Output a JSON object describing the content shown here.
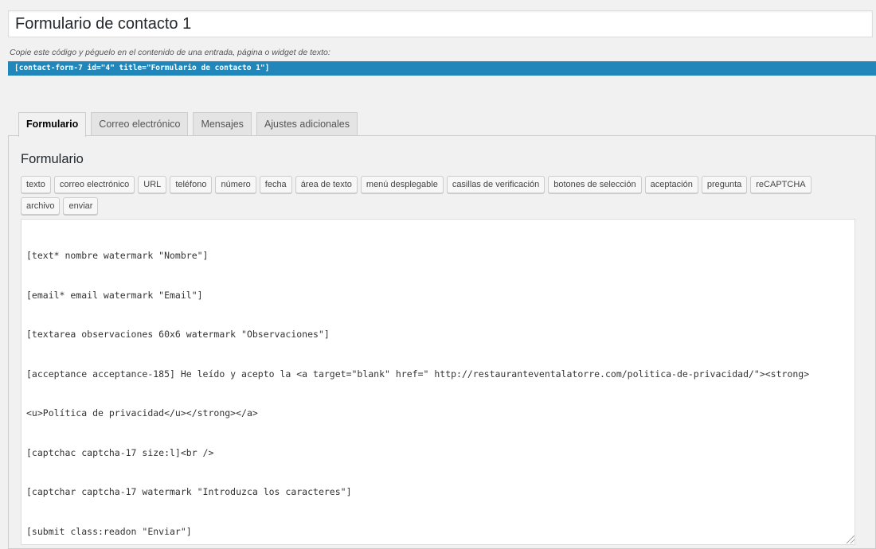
{
  "form": {
    "title_value": "Formulario de contacto 1",
    "shortcode_description": "Copie este código y péguelo en el contenido de una entrada, página o widget de texto:",
    "shortcode": "[contact-form-7 id=\"4\" title=\"Formulario de contacto 1\"]"
  },
  "tabs": [
    {
      "label": "Formulario",
      "active": true
    },
    {
      "label": "Correo electrónico",
      "active": false
    },
    {
      "label": "Mensajes",
      "active": false
    },
    {
      "label": "Ajustes adicionales",
      "active": false
    }
  ],
  "panel": {
    "heading": "Formulario",
    "tag_buttons": [
      "texto",
      "correo electrónico",
      "URL",
      "teléfono",
      "número",
      "fecha",
      "área de texto",
      "menú desplegable",
      "casillas de verificación",
      "botones de selección",
      "aceptación",
      "pregunta",
      "reCAPTCHA",
      "archivo",
      "enviar"
    ],
    "editor_lines": [
      "[text* nombre watermark \"Nombre\"]",
      "[email* email watermark \"Email\"]",
      "[textarea observaciones 60x6 watermark \"Observaciones\"]",
      "[acceptance acceptance-185] He leído y acepto la <a target=\"blank\" href=\" http://restauranteventalatorre.com/politica-de-privacidad/\"><strong>",
      "<u>Política de privacidad</u></strong></a>",
      "[captchac captcha-17 size:l]<br />",
      "[captchar captcha-17 watermark \"Introduzca los caracteres\"]",
      "[submit class:readon \"Enviar\"]"
    ]
  }
}
